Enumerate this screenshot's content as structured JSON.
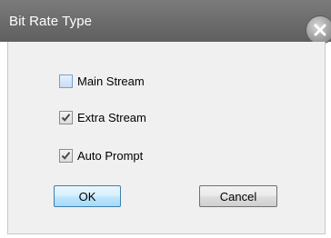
{
  "dialog": {
    "title": "Bit Rate Type"
  },
  "options": [
    {
      "label": "Main Stream",
      "checked": false
    },
    {
      "label": "Extra Stream",
      "checked": true
    },
    {
      "label": "Auto Prompt",
      "checked": true
    }
  ],
  "buttons": {
    "ok_label": "OK",
    "cancel_label": "Cancel"
  },
  "icons": {
    "close": "close-icon",
    "check": "checkmark-icon"
  }
}
